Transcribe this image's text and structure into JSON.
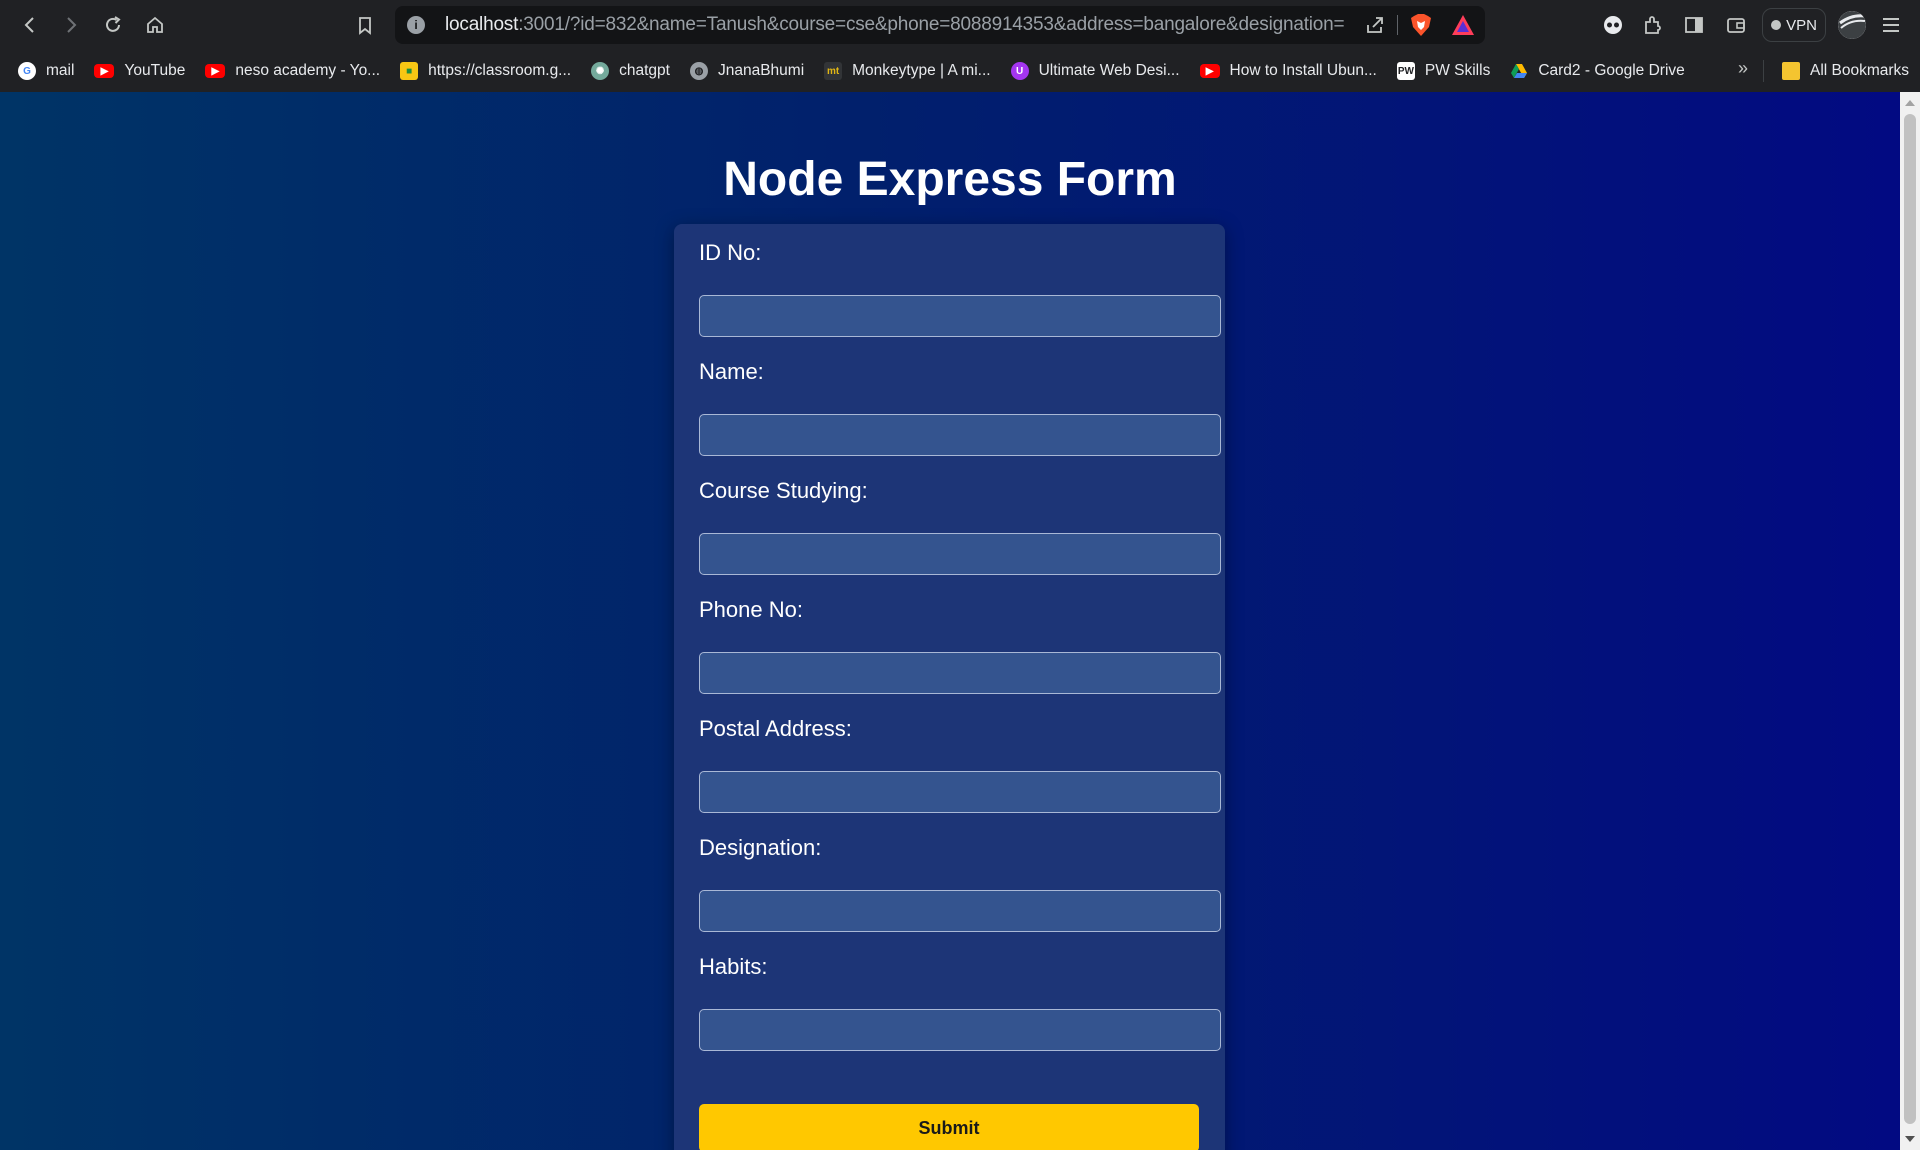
{
  "browser": {
    "url_host": "localhost",
    "url_rest": ":3001/?id=832&name=Tanush&course=cse&phone=8088914353&address=bangalore&designation=stud...",
    "vpn_label": "VPN"
  },
  "bookmarks": [
    {
      "label": "mail",
      "icon": "google-icon",
      "color": "#ffffff"
    },
    {
      "label": "YouTube",
      "icon": "youtube-icon",
      "color": "#ff0000"
    },
    {
      "label": "neso academy - Yo...",
      "icon": "youtube-icon",
      "color": "#ff0000"
    },
    {
      "label": "https://classroom.g...",
      "icon": "classroom-icon",
      "color": "#f7c614"
    },
    {
      "label": "chatgpt",
      "icon": "chatgpt-icon",
      "color": "#74aa9c"
    },
    {
      "label": "JnanaBhumi",
      "icon": "globe-icon",
      "color": "#9aa0a6"
    },
    {
      "label": "Monkeytype | A mi...",
      "icon": "monkeytype-icon",
      "color": "#e2b714"
    },
    {
      "label": "Ultimate Web Desi...",
      "icon": "udemy-icon",
      "color": "#a435f0"
    },
    {
      "label": "How to Install Ubun...",
      "icon": "youtube-icon",
      "color": "#ff0000"
    },
    {
      "label": "PW Skills",
      "icon": "pwskills-icon",
      "color": "#ffffff"
    },
    {
      "label": "Card2 - Google Drive",
      "icon": "drive-icon",
      "color": "#34a853"
    }
  ],
  "bookmarks_more": "»",
  "all_bookmarks": "All Bookmarks",
  "form": {
    "title": "Node Express Form",
    "fields": [
      {
        "label": "ID No:",
        "value": ""
      },
      {
        "label": "Name:",
        "value": ""
      },
      {
        "label": "Course Studying:",
        "value": ""
      },
      {
        "label": "Phone No:",
        "value": ""
      },
      {
        "label": "Postal Address:",
        "value": ""
      },
      {
        "label": "Designation:",
        "value": ""
      },
      {
        "label": "Habits:",
        "value": ""
      }
    ],
    "submit_label": "Submit"
  },
  "colors": {
    "page_gradient_start": "#003466",
    "page_gradient_end": "#020a82",
    "card": "#1d3577",
    "input": "#34548f",
    "submit": "#ffc800"
  }
}
